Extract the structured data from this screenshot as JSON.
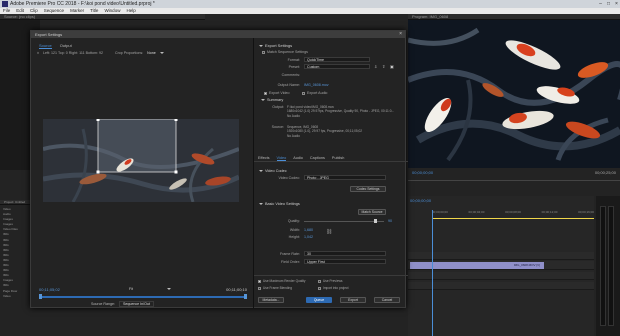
{
  "window": {
    "title": "Adobe Premiere Pro CC 2018 - F:\\koi pond video\\Untitled.prproj *"
  },
  "menu": [
    "File",
    "Edit",
    "Clip",
    "Sequence",
    "Marker",
    "Title",
    "Window",
    "Help"
  ],
  "source_panel": {
    "title": "Source: (no clips)"
  },
  "program_panel": {
    "title": "Program: IMG_0608",
    "timecode_left": "00;00;00;00",
    "timecode_right": "00;00;25;00"
  },
  "project_panel": {
    "title": "Project: Untitled",
    "items": [
      "Video",
      "Audio",
      "Images",
      "Images",
      "Video Files",
      "IMG",
      "IMG",
      "IMG",
      "IMG",
      "IMG",
      "IMG",
      "IMG",
      "IMG",
      "IMG",
      "Images",
      "IMG",
      "Page Flow",
      "Video"
    ]
  },
  "timeline": {
    "clip_label": "IMG_0608.MOV [V]",
    "timecode": "00;00;00;00",
    "ruler": [
      "00;00;00;00",
      "00;00;04;00",
      "00;00;08;00",
      "00;00;12;00",
      "00;00;16;00",
      "00;00;20;00"
    ]
  },
  "export": {
    "dialog_title": "Export Settings",
    "tabs": [
      "Source",
      "Output"
    ],
    "toolbar": {
      "crop_values": "Left: 121  Top: 0  Right: 111  Bottom: 92",
      "crop_proportions_label": "Crop Proportions:",
      "crop_proportions_value": "None"
    },
    "playback": {
      "timecode_in": "00;11;05;02",
      "timecode_out": "00;11;00;10",
      "fit_label": "Fit",
      "source_range_label": "Source Range:",
      "source_range_value": "Sequence In/Out"
    },
    "settings": {
      "header": "Export Settings",
      "match_sequence": "Match Sequence Settings",
      "format_label": "Format:",
      "format_value": "QuickTime",
      "preset_label": "Preset:",
      "preset_value": "Custom",
      "comments_label": "Comments:",
      "output_name_label": "Output Name:",
      "output_name_value": "IMG_0608.mov",
      "export_video": "Export Video",
      "export_audio": "Export Audio",
      "summary_header": "Summary",
      "output_label": "Output:",
      "output_text": "F:\\koi pond video\\IMG_0608.mov\n1680x1042 (1.0) 29.97fps, Progressive, Quality 90, Photo - JPEG, 00:11:0...\nNo Audio",
      "source_label": "Source:",
      "source_text": "Sequence, IMG_0608\n1920x1080 (1.0), 29.97 fps, Progressive, 00;11;05;02\nNo Audio"
    },
    "subtabs": [
      "Effects",
      "Video",
      "Audio",
      "Captions",
      "Publish"
    ],
    "video": {
      "codec_header": "Video Codec",
      "codec_label": "Video Codec:",
      "codec_value": "Photo - JPEG",
      "codec_settings_btn": "Codec Settings",
      "basic_header": "Basic Video Settings",
      "match_source_btn": "Match Source",
      "quality_label": "Quality:",
      "quality_value": "90",
      "width_label": "Width:",
      "width_value": "1,680",
      "height_label": "Height:",
      "height_value": "1,042",
      "frame_rate_label": "Frame Rate:",
      "frame_rate_value": "30",
      "field_order_label": "Field Order:",
      "field_order_value": "Upper First"
    },
    "options": {
      "max_render_quality": "Use Maximum Render Quality",
      "use_previews": "Use Previews",
      "frame_blending": "Use Frame Blending",
      "import_into_project": "Import into project"
    },
    "buttons": {
      "metadata": "Metadata...",
      "queue": "Queue",
      "export": "Export",
      "cancel": "Cancel"
    }
  }
}
